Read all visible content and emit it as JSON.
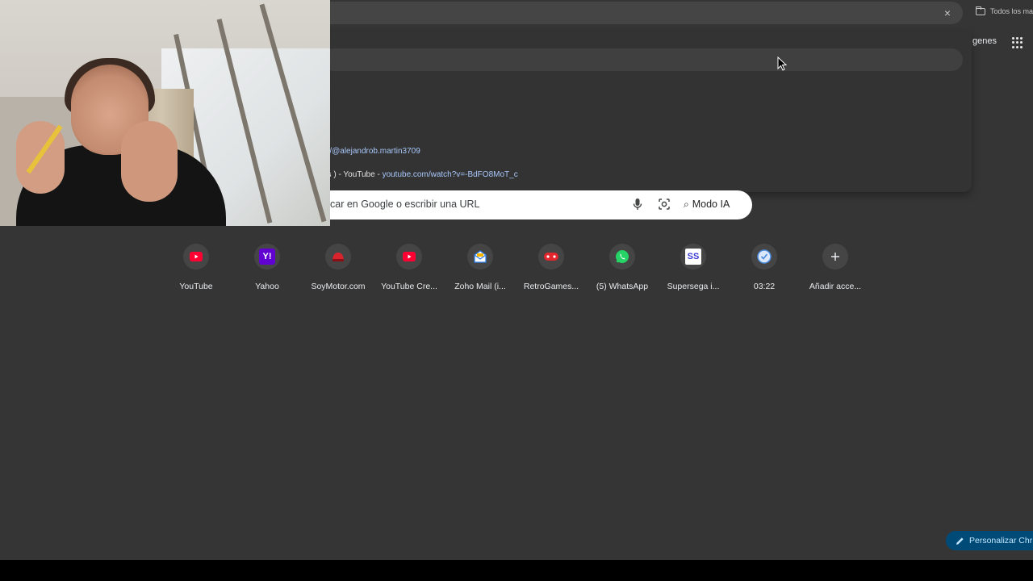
{
  "top_bar": {
    "close_glyph": "×",
    "all_bookmarks": "Todos los ma"
  },
  "header": {
    "images_link": "genes"
  },
  "suggestions": [
    {
      "title": "",
      "url": "m/@alejandrob.martin3709"
    },
    {
      "title": "us ) - YouTube - ",
      "url": "youtube.com/watch?v=-BdFO8MoT_c"
    }
  ],
  "search": {
    "placeholder": "car en Google o escribir una URL",
    "ai_mode_label": "Modo IA"
  },
  "shortcuts": [
    {
      "label": "YouTube",
      "icon": "youtube-icon",
      "color": "#ff0033"
    },
    {
      "label": "Yahoo",
      "icon": "yahoo-icon",
      "color": "#6001d2"
    },
    {
      "label": "SoyMotor.com",
      "icon": "soymotor-icon",
      "color": "#d9232d"
    },
    {
      "label": "YouTube Cre...",
      "icon": "youtube-icon",
      "color": "#ff0033"
    },
    {
      "label": "Zoho Mail (i...",
      "icon": "zoho-mail-icon",
      "color": "#2c7be5"
    },
    {
      "label": "RetroGames...",
      "icon": "gamepad-icon",
      "color": "#e3262e"
    },
    {
      "label": "(5) WhatsApp",
      "icon": "whatsapp-icon",
      "color": "#25d366"
    },
    {
      "label": "Supersega i...",
      "icon": "supersega-icon",
      "color": "#3b3bd6"
    },
    {
      "label": "03:22",
      "icon": "clock-icon",
      "color": "#4a8bdc"
    },
    {
      "label": "Añadir acce...",
      "icon": "plus-icon",
      "color": "#e8eaed"
    }
  ],
  "supersega_text": "SS",
  "yahoo_text": "Y!",
  "customize_label": "Personalizar Chr"
}
